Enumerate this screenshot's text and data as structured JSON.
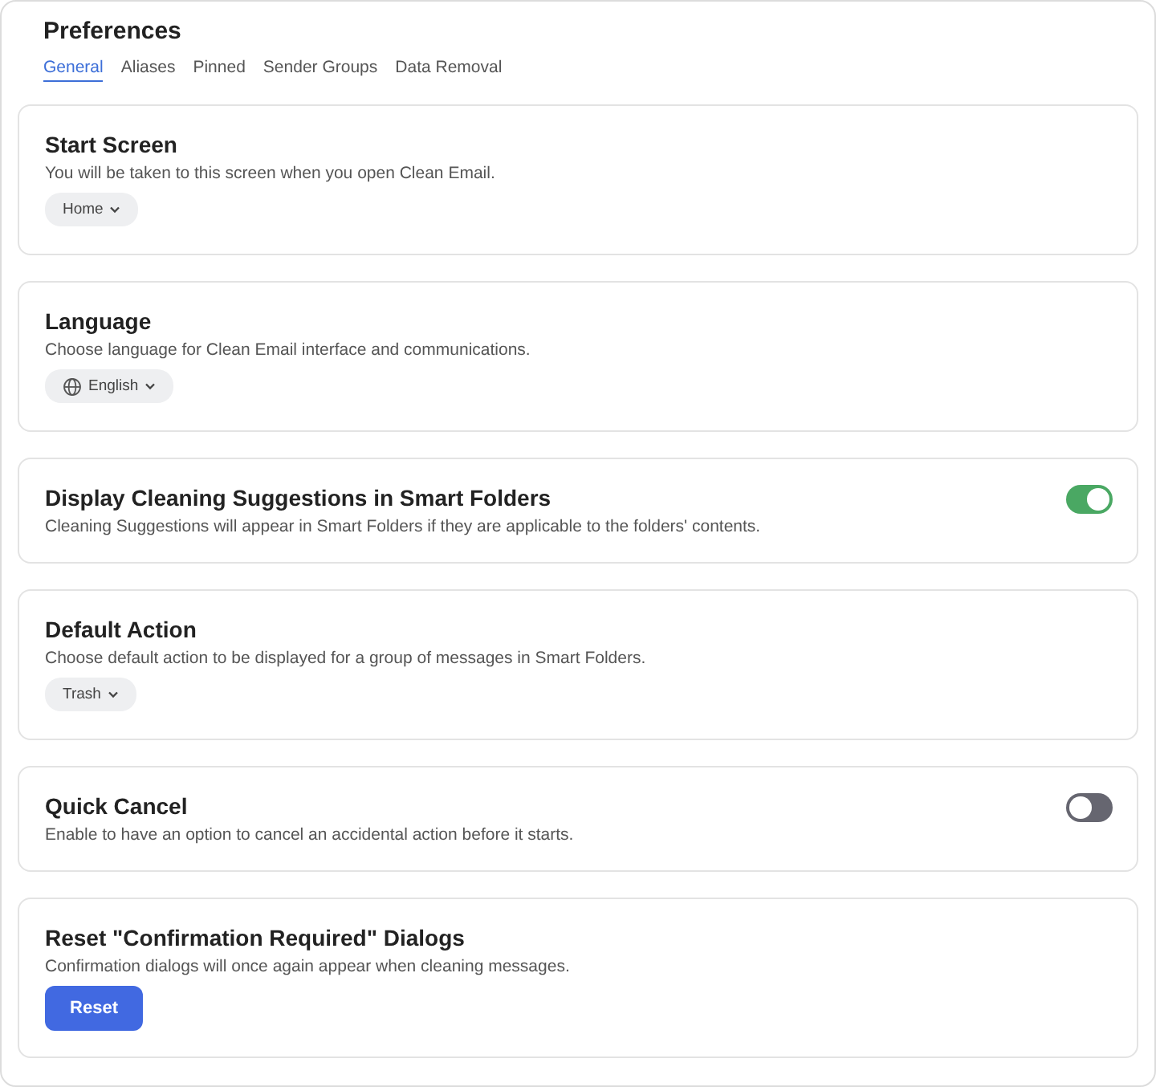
{
  "title": "Preferences",
  "tabs": [
    {
      "label": "General",
      "selected": true
    },
    {
      "label": "Aliases",
      "selected": false
    },
    {
      "label": "Pinned",
      "selected": false
    },
    {
      "label": "Sender Groups",
      "selected": false
    },
    {
      "label": "Data Removal",
      "selected": false
    }
  ],
  "sections": [
    {
      "kind": "dropdown",
      "title": "Start Screen",
      "description": "You will be taken to this screen when you open Clean Email.",
      "value": "Home"
    },
    {
      "kind": "globe-dropdown",
      "title": "Language",
      "description": "Choose language for Clean Email interface and communications.",
      "value": "English"
    },
    {
      "kind": "toggle",
      "title": "Display Cleaning Suggestions in Smart Folders",
      "description": "Cleaning Suggestions will appear in Smart Folders if they are applicable to the folders' contents.",
      "on": true
    },
    {
      "kind": "dropdown",
      "title": "Default Action",
      "description": "Choose default action to be displayed for a group of messages in Smart Folders.",
      "value": "Trash"
    },
    {
      "kind": "toggle",
      "title": "Quick Cancel",
      "description": "Enable to have an option to cancel an accidental action before it starts.",
      "on": false
    },
    {
      "kind": "button",
      "title": "Reset \"Confirmation Required\" Dialogs",
      "description": "Confirmation dialogs will once again appear when cleaning messages.",
      "button": "Reset"
    }
  ]
}
